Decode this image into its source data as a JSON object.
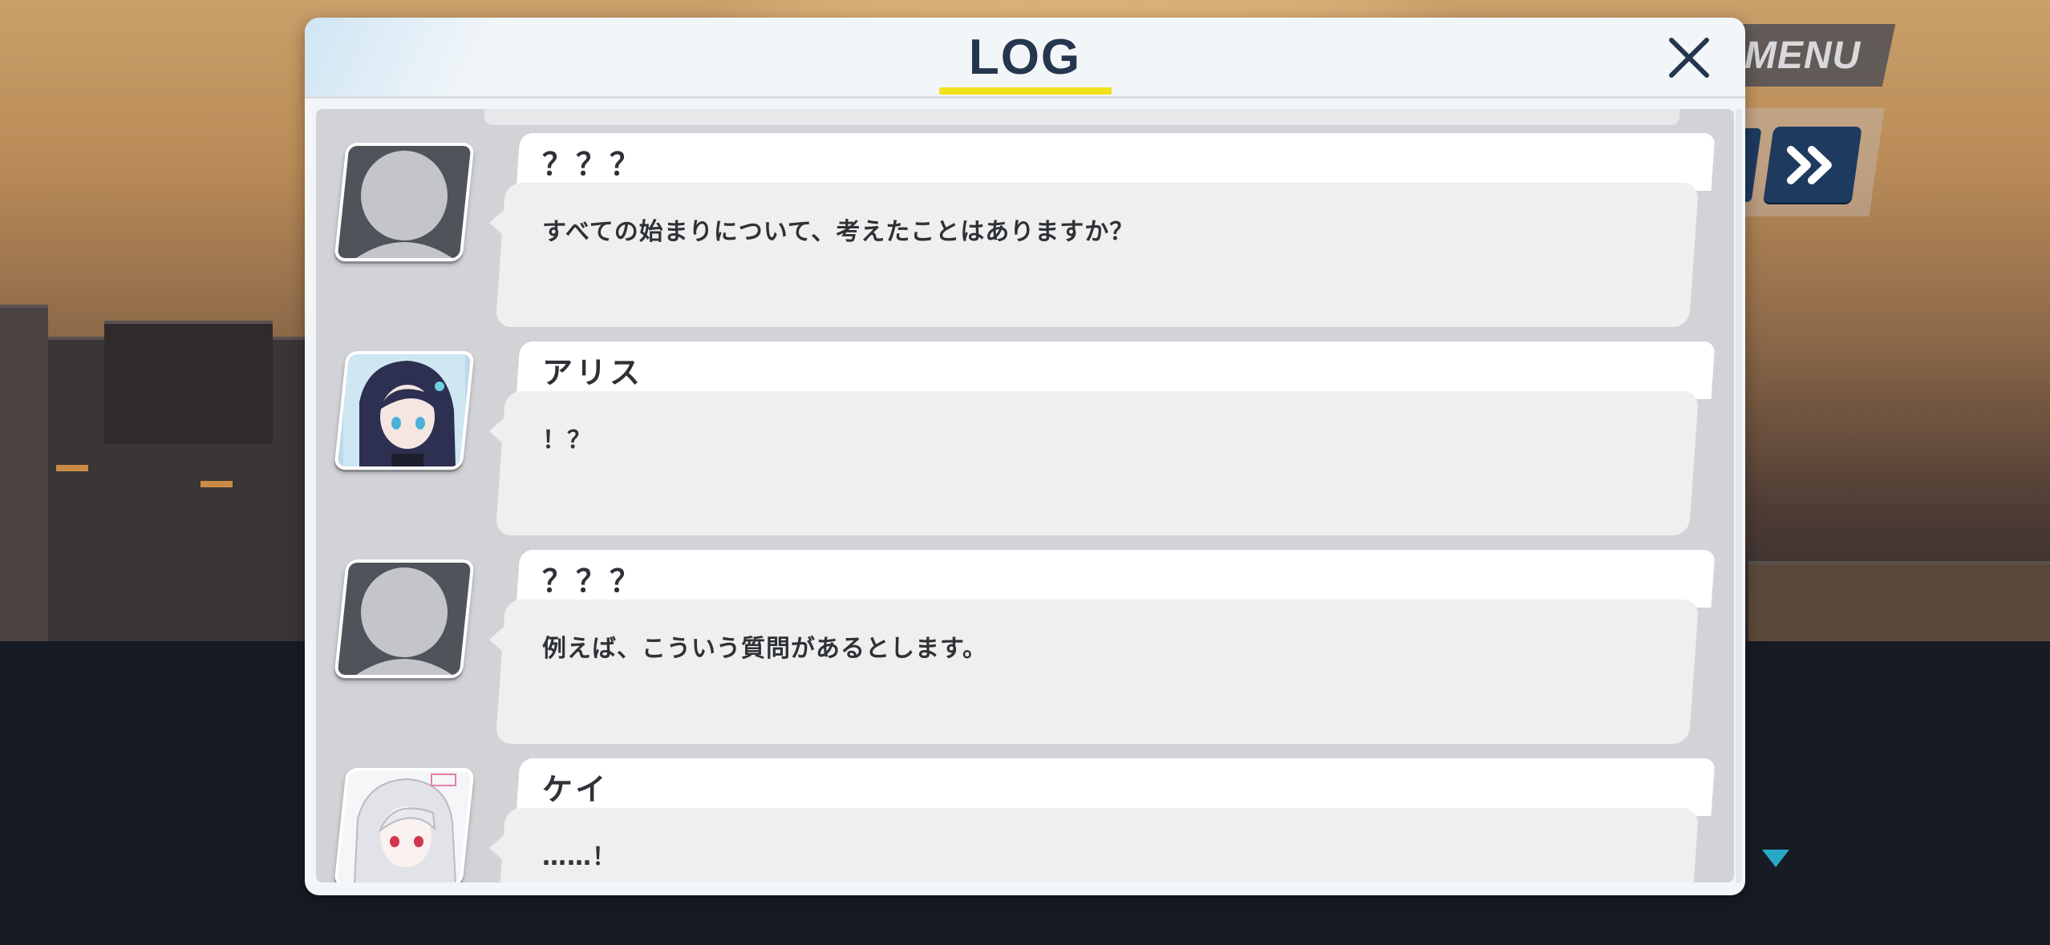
{
  "hud": {
    "menu_label": "MENU",
    "auto_icon": "auto-icon",
    "skip_icon": "double-chevron-right-icon",
    "next_indicator_icon": "triangle-down-icon"
  },
  "log": {
    "title": "LOG",
    "close_icon": "close-icon",
    "accent_color": "#f3e11d",
    "entries": [
      {
        "speaker": "？？？",
        "text": "すべての始まりについて、考えたことはありますか？",
        "portrait": "silhouette"
      },
      {
        "speaker": "アリス",
        "text": "！？",
        "portrait": "arisu"
      },
      {
        "speaker": "？？？",
        "text": "例えば、こういう質問があるとします。",
        "portrait": "silhouette"
      },
      {
        "speaker": "ケイ",
        "text": "……！",
        "portrait": "kei"
      }
    ]
  }
}
